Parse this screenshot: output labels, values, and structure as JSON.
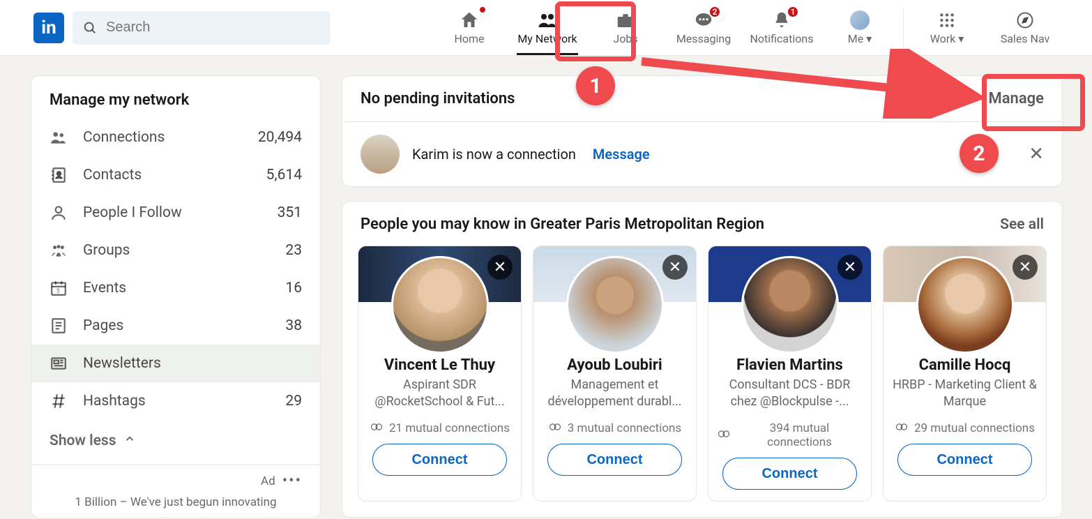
{
  "nav": {
    "search_placeholder": "Search",
    "items": [
      {
        "label": "Home"
      },
      {
        "label": "My Network"
      },
      {
        "label": "Jobs"
      },
      {
        "label": "Messaging",
        "badge": "2"
      },
      {
        "label": "Notifications",
        "badge": "1"
      },
      {
        "label": "Me"
      },
      {
        "label": "Work"
      },
      {
        "label": "Sales Nav"
      }
    ],
    "home_dot": true
  },
  "sidebar": {
    "title": "Manage my network",
    "items": [
      {
        "label": "Connections",
        "count": "20,494"
      },
      {
        "label": "Contacts",
        "count": "5,614"
      },
      {
        "label": "People I Follow",
        "count": "351"
      },
      {
        "label": "Groups",
        "count": "23"
      },
      {
        "label": "Events",
        "count": "16"
      },
      {
        "label": "Pages",
        "count": "38"
      },
      {
        "label": "Newsletters",
        "count": ""
      },
      {
        "label": "Hashtags",
        "count": "29"
      }
    ],
    "show_less": "Show less",
    "ad_label": "Ad",
    "ad_text": "1 Billion – We've just begun innovating"
  },
  "invitations": {
    "header": "No pending invitations",
    "manage": "Manage",
    "connection_text": "Karim is now a connection",
    "message_label": "Message"
  },
  "pymk": {
    "header": "People you may know in Greater Paris Metropolitan Region",
    "see_all": "See all",
    "connect_label": "Connect",
    "cards": [
      {
        "name": "Vincent Le Thuy",
        "headline": "Aspirant SDR @RocketSchool & Fut...",
        "mutual": "21 mutual connections"
      },
      {
        "name": "Ayoub Loubiri",
        "headline": "Management et développement durabl...",
        "mutual": "3 mutual connections"
      },
      {
        "name": "Flavien Martins",
        "headline": "Consultant DCS - BDR chez @Blockpulse -...",
        "mutual": "394 mutual connections"
      },
      {
        "name": "Camille Hocq",
        "headline": "HRBP - Marketing Client & Marque",
        "mutual": "29 mutual connections"
      }
    ]
  },
  "annotations": {
    "step1": "1",
    "step2": "2"
  }
}
